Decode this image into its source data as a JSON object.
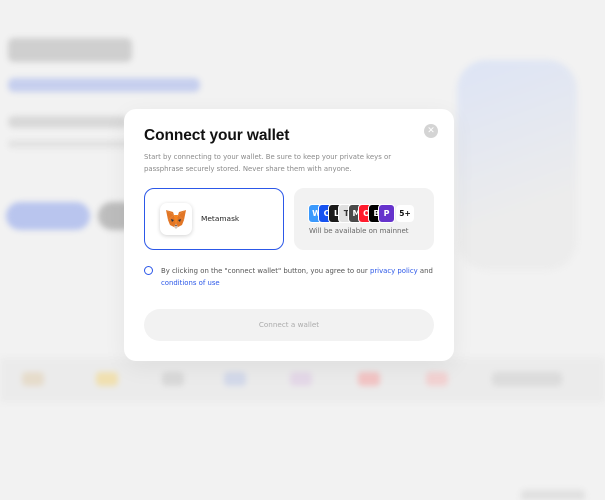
{
  "modal": {
    "title": "Connect your wallet",
    "description": "Start by connecting to your wallet. Be sure to keep your private keys or passphrase securely stored. Never share them with anyone.",
    "close_icon": "close-icon",
    "options": [
      {
        "label": "Metamask",
        "icon": "metamask-fox-icon",
        "selected": true
      },
      {
        "caption": "Will be available on mainnet",
        "more_badge": "5+",
        "icons": [
          {
            "name": "walletconnect-icon",
            "glyph": "W",
            "color": "#3b99fc"
          },
          {
            "name": "coinbase-icon",
            "glyph": "C",
            "color": "#1652f0"
          },
          {
            "name": "ledger-icon",
            "glyph": "L",
            "color": "#1a1a1a"
          },
          {
            "name": "trezor-icon",
            "glyph": "T",
            "color": "#e0e0e0"
          },
          {
            "name": "torus-icon",
            "glyph": "M",
            "color": "#4a4a4a"
          },
          {
            "name": "opera-icon",
            "glyph": "O",
            "color": "#ff1b2d"
          },
          {
            "name": "binance-icon",
            "glyph": "B",
            "color": "#000000"
          },
          {
            "name": "portis-icon",
            "glyph": "P",
            "color": "#6633cc"
          }
        ]
      }
    ],
    "agreement": {
      "text_before": "By clicking on the \"connect wallet\" button, you agree to our ",
      "privacy_link": "privacy policy",
      "middle": " and",
      "conditions_link": "conditions of use"
    },
    "connect_button": "Connect a wallet"
  },
  "colors": {
    "accent": "#2c58e8",
    "overlay_background": "#f2f2f2",
    "button_disabled_bg": "#f2f2f2",
    "button_disabled_text": "#ababab"
  }
}
